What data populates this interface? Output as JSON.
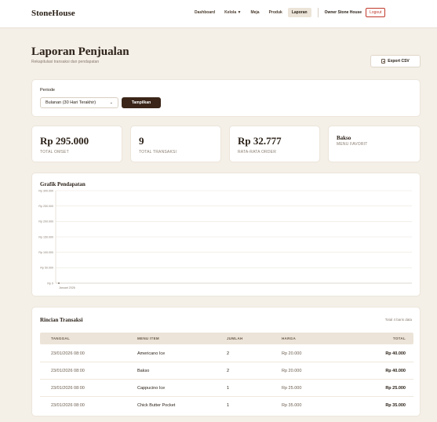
{
  "brand": "StoneHouse",
  "nav": {
    "items": [
      {
        "label": "Dashboard"
      },
      {
        "label": "Kelola ▼"
      },
      {
        "label": "Meja"
      },
      {
        "label": "Produk"
      },
      {
        "label": "Laporan"
      }
    ],
    "active": "Laporan",
    "owner": "Owner Stone House",
    "logout": "Logout"
  },
  "page": {
    "title": "Laporan Penjualan",
    "subtitle": "Rekapitulasi transaksi dan pendapatan",
    "export_label": "Export CSV"
  },
  "filter": {
    "label": "Periode",
    "selected": "Bulanan (30 Hari Terakhir)",
    "button": "Tampilkan"
  },
  "stats": [
    {
      "value": "Rp 295.000",
      "label": "TOTAL OMSET"
    },
    {
      "value": "9",
      "label": "TOTAL TRANSAKSI"
    },
    {
      "value": "Rp 32.777",
      "label": "RATA-RATA ORDER"
    },
    {
      "value": "Bakso",
      "label": "MENU FAVORIT"
    }
  ],
  "chart_data": {
    "type": "line",
    "title": "Grafik Pendapatan",
    "y_ticks": [
      "Rp 0",
      "Rp 50.000",
      "Rp 100.000",
      "Rp 150.000",
      "Rp 200.000",
      "Rp 250.000",
      "Rp 300.000"
    ],
    "ylim": [
      0,
      300000
    ],
    "x_labels": [
      "Januari 2026"
    ],
    "series": [
      {
        "values": [
          0
        ]
      }
    ],
    "grid": true
  },
  "table": {
    "title": "Rincian Transaksi",
    "total_text": "Total 4 baris data",
    "headers": [
      "TANGGAL",
      "MENU ITEM",
      "JUMLAH",
      "HARGA",
      "TOTAL"
    ],
    "rows": [
      [
        "23/01/2026 08:00",
        "Americano Ice",
        "2",
        "Rp 20.000",
        "Rp 40.000"
      ],
      [
        "23/01/2026 08:00",
        "Bakso",
        "2",
        "Rp 20.000",
        "Rp 40.000"
      ],
      [
        "23/01/2026 08:00",
        "Cappucino Ice",
        "1",
        "Rp 25.000",
        "Rp 25.000"
      ],
      [
        "23/01/2026 08:00",
        "Chick Butter Pocket",
        "1",
        "Rp 35.000",
        "Rp 35.000"
      ]
    ]
  },
  "colors": {
    "accent": "#3a2518",
    "background": "#f4efe7",
    "logout": "#c0392b"
  }
}
